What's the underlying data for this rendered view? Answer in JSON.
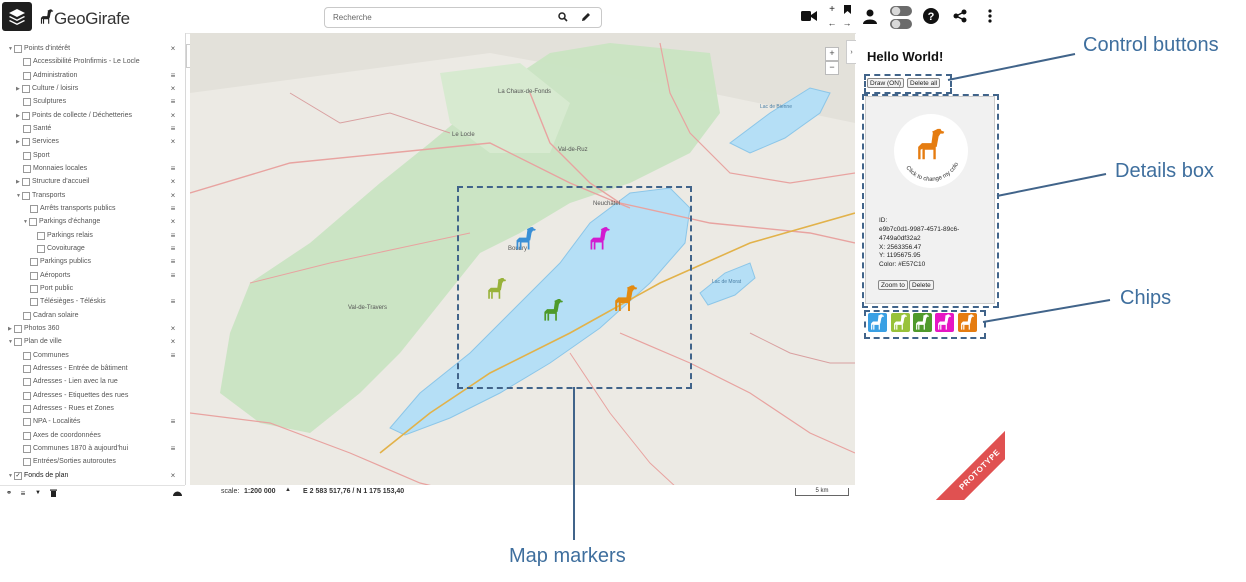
{
  "app": {
    "logo_text": "GeoGirafe"
  },
  "search": {
    "placeholder": "Recherche"
  },
  "layer_tree": [
    {
      "label": "Points d'intérêt",
      "expanded": true,
      "action": "×"
    },
    {
      "label": "Accessibilité ProInfirmis - Le Locle",
      "action": ""
    },
    {
      "label": "Administration",
      "action": "≡"
    },
    {
      "label": "Culture / loisirs",
      "action": "×"
    },
    {
      "label": "Sculptures",
      "action": "≡"
    },
    {
      "label": "Points de collecte / Déchetteries",
      "action": "×"
    },
    {
      "label": "Santé",
      "action": "≡"
    },
    {
      "label": "Services",
      "action": "×"
    },
    {
      "label": "Sport",
      "action": ""
    },
    {
      "label": "Monnaies locales",
      "action": "≡"
    },
    {
      "label": "Structure d'accueil",
      "action": "×"
    },
    {
      "label": "Transports",
      "action": "×"
    },
    {
      "label": "Arrêts transports publics",
      "action": "≡"
    },
    {
      "label": "Parkings d'échange",
      "action": "×"
    },
    {
      "label": "Parkings relais",
      "action": "≡"
    },
    {
      "label": "Covoiturage",
      "action": "≡"
    },
    {
      "label": "Parkings publics",
      "action": "≡"
    },
    {
      "label": "Aéroports",
      "action": "≡"
    },
    {
      "label": "Port public",
      "action": ""
    },
    {
      "label": "Télésièges - Téléskis",
      "action": "≡"
    },
    {
      "label": "Cadran solaire",
      "action": ""
    },
    {
      "label": "Photos 360",
      "action": "×"
    },
    {
      "label": "Plan de ville",
      "action": "×"
    },
    {
      "label": "Communes",
      "action": "≡"
    },
    {
      "label": "Adresses - Entrée de bâtiment",
      "action": ""
    },
    {
      "label": "Adresses - Lien avec la rue",
      "action": ""
    },
    {
      "label": "Adresses - Etiquettes des rues",
      "action": ""
    },
    {
      "label": "Adresses - Rues et Zones",
      "action": ""
    },
    {
      "label": "NPA - Localités",
      "action": "≡"
    },
    {
      "label": "Axes de coordonnées",
      "action": ""
    },
    {
      "label": "Communes 1870 à aujourd'hui",
      "action": "≡"
    },
    {
      "label": "Entrées/Sorties autoroutes",
      "action": ""
    },
    {
      "label": "Fonds de plan",
      "action": "×"
    }
  ],
  "map": {
    "place_labels": [
      "La Chaux-de-Fonds",
      "Le Locle",
      "Val-de-Ruz",
      "Neuchâtel",
      "Boudry",
      "Val-de-Travers",
      "Lac de Bienne",
      "Lac de Morat"
    ],
    "zoom_in": "+",
    "zoom_out": "−",
    "scale_label": "scale:",
    "scale_value": "1:200 000",
    "coordinates": "E 2 583 517,76 / N 1 175 153,40",
    "scale_bar": "5 km"
  },
  "panel": {
    "title": "Hello World!",
    "draw_button": "Draw (ON)",
    "delete_all_button": "Delete all",
    "avatar_caption": "Click to change my color!",
    "id_label": "ID:",
    "id_value_1": "e9b7c0d1-9987-4571-89c6-",
    "id_value_2": "4749a0df32a2",
    "x_text": "X: 2563356.47",
    "y_text": "Y: 1195675.95",
    "color_text": "Color: #E57C10",
    "zoom_to_button": "Zoom to",
    "delete_button": "Delete"
  },
  "chips": [
    {
      "color": "#3aa0e4"
    },
    {
      "color": "#98c23a"
    },
    {
      "color": "#4f9a2c"
    },
    {
      "color": "#e616c4"
    },
    {
      "color": "#e57c10"
    }
  ],
  "markers": [
    {
      "color": "#3a8fd6"
    },
    {
      "color": "#d21bd0"
    },
    {
      "color": "#98b23a"
    },
    {
      "color": "#4e9a2a"
    },
    {
      "color": "#e38a10"
    }
  ],
  "ribbon": {
    "text": "PROTOTYPE"
  },
  "callouts": {
    "control_buttons": "Control buttons",
    "details_box": "Details box",
    "chips": "Chips",
    "map_markers": "Map markers"
  },
  "colors": {
    "annotation": "#3f6f9e",
    "lake": "#b5dff6",
    "forest": "#c9e4c2",
    "ribbon": "#e05151"
  }
}
